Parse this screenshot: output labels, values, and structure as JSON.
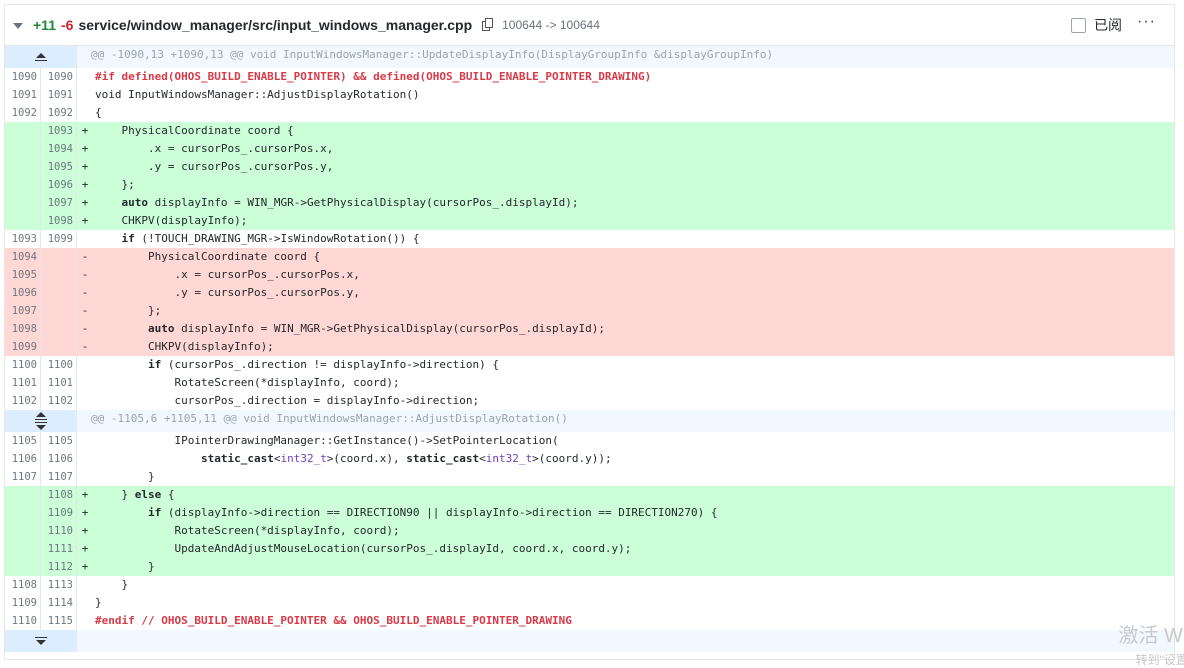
{
  "file_header": {
    "additions": "+11",
    "deletions": "-6",
    "path": "service/window_manager/src/input_windows_manager.cpp",
    "mode_change": "100644 -> 100644",
    "viewed_label": "已阅",
    "more_label": "···"
  },
  "rows": [
    {
      "type": "hunk",
      "expand": "up",
      "text": "@@ -1090,13 +1090,13 @@ void InputWindowsManager::UpdateDisplayInfo(DisplayGroupInfo &displayGroupInfo)"
    },
    {
      "type": "ctx",
      "old": "1090",
      "new": "1090",
      "sign": "",
      "segs": [
        {
          "t": "#if defined(OHOS_BUILD_ENABLE_POINTER) && defined(OHOS_BUILD_ENABLE_POINTER_DRAWING)",
          "c": "pp"
        }
      ]
    },
    {
      "type": "ctx",
      "old": "1091",
      "new": "1091",
      "sign": "",
      "segs": [
        {
          "t": "void InputWindowsManager::AdjustDisplayRotation()"
        }
      ]
    },
    {
      "type": "ctx",
      "old": "1092",
      "new": "1092",
      "sign": "",
      "segs": [
        {
          "t": "{"
        }
      ]
    },
    {
      "type": "add",
      "old": "",
      "new": "1093",
      "sign": "+",
      "segs": [
        {
          "t": "    PhysicalCoordinate coord {"
        }
      ]
    },
    {
      "type": "add",
      "old": "",
      "new": "1094",
      "sign": "+",
      "segs": [
        {
          "t": "        .x = cursorPos_.cursorPos.x,"
        }
      ]
    },
    {
      "type": "add",
      "old": "",
      "new": "1095",
      "sign": "+",
      "segs": [
        {
          "t": "        .y = cursorPos_.cursorPos.y,"
        }
      ]
    },
    {
      "type": "add",
      "old": "",
      "new": "1096",
      "sign": "+",
      "segs": [
        {
          "t": "    };"
        }
      ]
    },
    {
      "type": "add",
      "old": "",
      "new": "1097",
      "sign": "+",
      "segs": [
        {
          "t": "    "
        },
        {
          "t": "auto",
          "c": "kw"
        },
        {
          "t": " displayInfo = WIN_MGR->GetPhysicalDisplay(cursorPos_.displayId);"
        }
      ]
    },
    {
      "type": "add",
      "old": "",
      "new": "1098",
      "sign": "+",
      "segs": [
        {
          "t": "    CHKPV(displayInfo);"
        }
      ]
    },
    {
      "type": "ctx",
      "old": "1093",
      "new": "1099",
      "sign": "",
      "segs": [
        {
          "t": "    "
        },
        {
          "t": "if",
          "c": "kw"
        },
        {
          "t": " (!TOUCH_DRAWING_MGR->IsWindowRotation()) {"
        }
      ]
    },
    {
      "type": "del",
      "old": "1094",
      "new": "",
      "sign": "-",
      "segs": [
        {
          "t": "        PhysicalCoordinate coord {"
        }
      ]
    },
    {
      "type": "del",
      "old": "1095",
      "new": "",
      "sign": "-",
      "segs": [
        {
          "t": "            .x = cursorPos_.cursorPos.x,"
        }
      ]
    },
    {
      "type": "del",
      "old": "1096",
      "new": "",
      "sign": "-",
      "segs": [
        {
          "t": "            .y = cursorPos_.cursorPos.y,"
        }
      ]
    },
    {
      "type": "del",
      "old": "1097",
      "new": "",
      "sign": "-",
      "segs": [
        {
          "t": "        };"
        }
      ]
    },
    {
      "type": "del",
      "old": "1098",
      "new": "",
      "sign": "-",
      "segs": [
        {
          "t": "        "
        },
        {
          "t": "auto",
          "c": "kw"
        },
        {
          "t": " displayInfo = WIN_MGR->GetPhysicalDisplay(cursorPos_.displayId);"
        }
      ]
    },
    {
      "type": "del",
      "old": "1099",
      "new": "",
      "sign": "-",
      "segs": [
        {
          "t": "        CHKPV(displayInfo);"
        }
      ]
    },
    {
      "type": "ctx",
      "old": "1100",
      "new": "1100",
      "sign": "",
      "segs": [
        {
          "t": "        "
        },
        {
          "t": "if",
          "c": "kw"
        },
        {
          "t": " (cursorPos_.direction != displayInfo->direction) {"
        }
      ]
    },
    {
      "type": "ctx",
      "old": "1101",
      "new": "1101",
      "sign": "",
      "segs": [
        {
          "t": "            RotateScreen(*displayInfo, coord);"
        }
      ]
    },
    {
      "type": "ctx",
      "old": "1102",
      "new": "1102",
      "sign": "",
      "segs": [
        {
          "t": "            cursorPos_.direction = displayInfo->direction;"
        }
      ]
    },
    {
      "type": "hunk",
      "expand": "both",
      "text": "@@ -1105,6 +1105,11 @@ void InputWindowsManager::AdjustDisplayRotation()"
    },
    {
      "type": "ctx",
      "old": "1105",
      "new": "1105",
      "sign": "",
      "segs": [
        {
          "t": "            IPointerDrawingManager::GetInstance()->SetPointerLocation("
        }
      ]
    },
    {
      "type": "ctx",
      "old": "1106",
      "new": "1106",
      "sign": "",
      "segs": [
        {
          "t": "                "
        },
        {
          "t": "static_cast",
          "c": "kw"
        },
        {
          "t": "<"
        },
        {
          "t": "int32_t",
          "c": "ty"
        },
        {
          "t": ">(coord.x), "
        },
        {
          "t": "static_cast",
          "c": "kw"
        },
        {
          "t": "<"
        },
        {
          "t": "int32_t",
          "c": "ty"
        },
        {
          "t": ">(coord.y));"
        }
      ]
    },
    {
      "type": "ctx",
      "old": "1107",
      "new": "1107",
      "sign": "",
      "segs": [
        {
          "t": "        }"
        }
      ]
    },
    {
      "type": "add",
      "old": "",
      "new": "1108",
      "sign": "+",
      "segs": [
        {
          "t": "    } "
        },
        {
          "t": "else",
          "c": "kw"
        },
        {
          "t": " {"
        }
      ]
    },
    {
      "type": "add",
      "old": "",
      "new": "1109",
      "sign": "+",
      "segs": [
        {
          "t": "        "
        },
        {
          "t": "if",
          "c": "kw"
        },
        {
          "t": " (displayInfo->direction == DIRECTION90 || displayInfo->direction == DIRECTION270) {"
        }
      ]
    },
    {
      "type": "add",
      "old": "",
      "new": "1110",
      "sign": "+",
      "segs": [
        {
          "t": "            RotateScreen(*displayInfo, coord);"
        }
      ]
    },
    {
      "type": "add",
      "old": "",
      "new": "1111",
      "sign": "+",
      "segs": [
        {
          "t": "            UpdateAndAdjustMouseLocation(cursorPos_.displayId, coord.x, coord.y);"
        }
      ]
    },
    {
      "type": "add",
      "old": "",
      "new": "1112",
      "sign": "+",
      "segs": [
        {
          "t": "        }"
        }
      ]
    },
    {
      "type": "ctx",
      "old": "1108",
      "new": "1113",
      "sign": "",
      "segs": [
        {
          "t": "    }"
        }
      ]
    },
    {
      "type": "ctx",
      "old": "1109",
      "new": "1114",
      "sign": "",
      "segs": [
        {
          "t": "}"
        }
      ]
    },
    {
      "type": "ctx",
      "old": "1110",
      "new": "1115",
      "sign": "",
      "segs": [
        {
          "t": "#endif // OHOS_BUILD_ENABLE_POINTER && OHOS_BUILD_ENABLE_POINTER_DRAWING",
          "c": "pp"
        }
      ]
    },
    {
      "type": "hunk",
      "expand": "down",
      "text": ""
    }
  ],
  "watermark": {
    "line1": "激活 Wir",
    "line2": "转到\"设置\""
  },
  "colors": {
    "addition_bg": "#ccffd8",
    "deletion_bg": "#ffd7d5",
    "hunk_bg": "#f1f8ff",
    "expander_bg": "#dbedff",
    "additions_text": "#22863a",
    "deletions_text": "#cb2431"
  }
}
